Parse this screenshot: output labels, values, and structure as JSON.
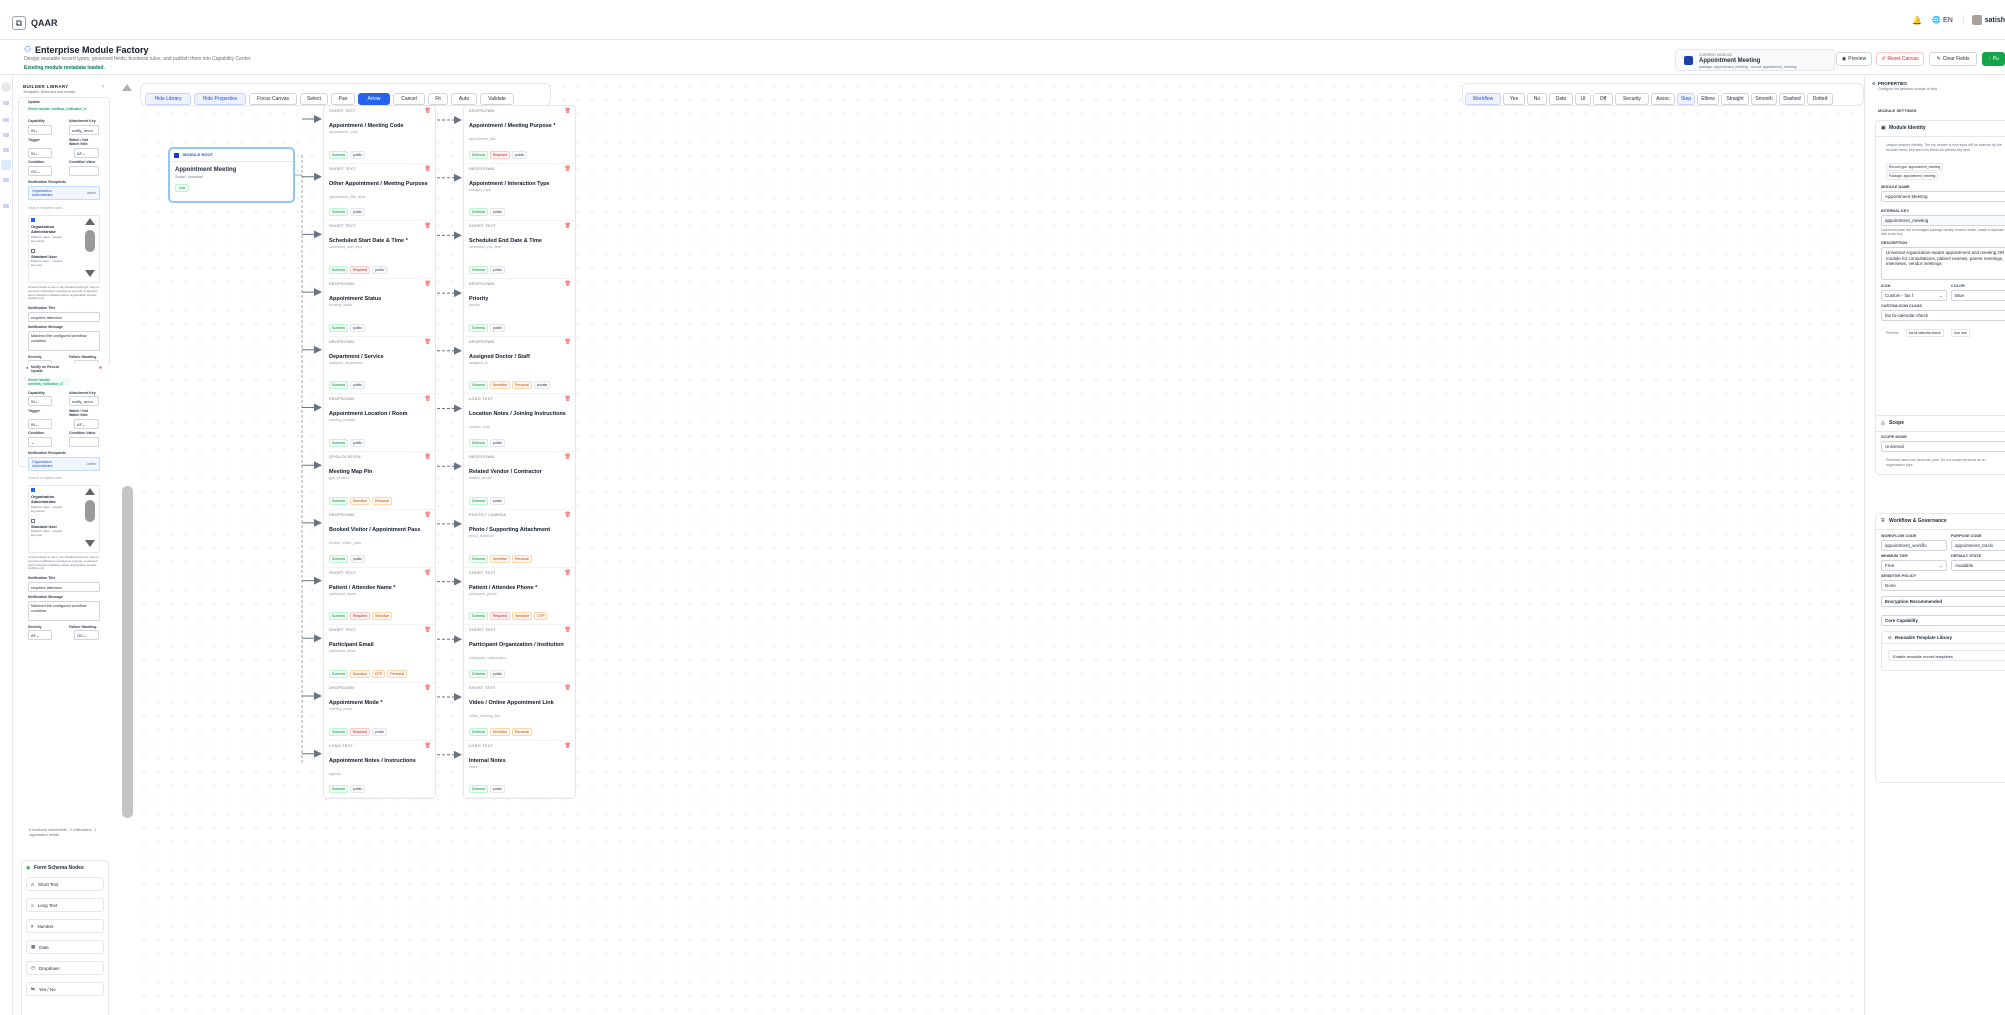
{
  "app": {
    "name": "QAAR",
    "language": "EN",
    "user": "satish"
  },
  "header": {
    "title": "Enterprise Module Factory",
    "subtitle": "Design reusable record types, governed fields, business rules, and publish them into Capability Center.",
    "status": "Existing module metadata loaded.",
    "current_module": {
      "caption": "CURRENT MODULE",
      "name": "Appointment Meeting",
      "path": "package: appointment_meeting · record: appointment_meeting"
    },
    "buttons": {
      "preview": "Preview",
      "reset": "Reset Canvas",
      "clear": "Clear Fields",
      "publish": "Pu"
    }
  },
  "library": {
    "title": "BUILDER LIBRARY",
    "subtitle": "Templates, fields and rule presets",
    "rule1": {
      "title": "Update",
      "code": "Server handler: workflow_notification_r1"
    },
    "rule2": {
      "title": "Notify on Record Update",
      "code": "Server handler: workflow_notification_r2"
    },
    "labels": {
      "capability": "Capability",
      "attr_key": "Attachment Key",
      "trigger": "Trigger",
      "watch": "Watch / Not Watch field",
      "condition": "Condition",
      "cond_value": "Condition Value",
      "recipients": "Notification Recipients",
      "search": "Search recipient roles...",
      "org_admin": "Organization Administrator",
      "org_admin_note": "Platform team · scoped key admin",
      "std_user": "Standard User",
      "std_user_note": "Platform team · scoped key user",
      "help": "Choose Roles to use in any Module Factory's rules to send the notification message to a group. A selected Send selection indicates active organisation access profiles only.",
      "notif_title": "Notification Title",
      "notif_title_val": "requires attention",
      "notif_msg": "Notification Message",
      "notif_msg_val": "Matched the configured workflow condition.",
      "severity": "Severity",
      "failure": "Failure Handling",
      "chip": "Organization Administrator",
      "chip2": "admin",
      "att_val": "notify_recor",
      "s1": "IN",
      "s2": "AF",
      "s3": "OC"
    },
    "summary": "5 functional rules/events · 2 notifications · 1 organisation details",
    "schema": {
      "title": "Form Schema Nodes",
      "items": [
        "Short Text",
        "Long Text",
        "Number",
        "Date",
        "Dropdown",
        "Yes / No"
      ]
    }
  },
  "toolbar": {
    "left": [
      "Hide Library",
      "Hide Properties",
      "Focus Canvas",
      "Select",
      "Pan",
      "Arrow",
      "Cancel",
      "Fit",
      "Auto",
      "Validate"
    ],
    "right": [
      "Workflow",
      "Yes",
      "No",
      "Date",
      "UI",
      "Off",
      "Security",
      "Assoc",
      "Step",
      "Elbow",
      "Straight",
      "Smooth",
      "Dashed",
      "Dotted"
    ]
  },
  "root": {
    "caption": "MODULE ROOT",
    "name": "Appointment Meeting",
    "scope": "Scope · Universal",
    "badge": "root"
  },
  "columns": [
    [
      {
        "type": "SHORT TEXT",
        "label": "Appointment / Meeting Code",
        "key": "appointment_code",
        "tags": [
          "Schema",
          "public"
        ]
      },
      {
        "type": "SHORT TEXT",
        "label": "Other Appointment / Meeting Purpose",
        "key": "appointment_title_other",
        "tags": [
          "Schema",
          "public"
        ]
      },
      {
        "type": "SHORT TEXT",
        "label": "Scheduled Start Date & Time *",
        "key": "scheduled_start_time",
        "tags": [
          "Schema",
          "Required",
          "public"
        ]
      },
      {
        "type": "DROPDOWN",
        "label": "Appointment Status",
        "key": "booking_status",
        "tags": [
          "Schema",
          "public"
        ]
      },
      {
        "type": "DROPDOWN",
        "label": "Department / Service",
        "key": "assigned_department",
        "tags": [
          "Schema",
          "public"
        ]
      },
      {
        "type": "DROPDOWN",
        "label": "Appointment Location / Room",
        "key": "meeting_location",
        "tags": [
          "Schema",
          "public"
        ]
      },
      {
        "type": "GPS/LOCATION",
        "label": "Meeting Map Pin",
        "key": "gps_location",
        "tags": [
          "Schema",
          "Sensitive",
          "Personal"
        ]
      },
      {
        "type": "DROPDOWN",
        "label": "Booked Visitor / Appointment Pass",
        "key": "booked_visitor_pass",
        "tags": [
          "Schema",
          "public"
        ]
      },
      {
        "type": "SHORT TEXT",
        "label": "Patient / Attendee Name *",
        "key": "participant_name",
        "tags": [
          "Schema",
          "Required",
          "Sensitive"
        ]
      },
      {
        "type": "SHORT TEXT",
        "label": "Participant Email",
        "key": "participant_email",
        "tags": [
          "Schema",
          "Sensitive",
          "OTP",
          "Personal"
        ]
      },
      {
        "type": "DROPDOWN",
        "label": "Appointment Mode *",
        "key": "meeting_mode",
        "tags": [
          "Schema",
          "Required",
          "public"
        ]
      },
      {
        "type": "LONG TEXT",
        "label": "Appointment Notes / Instructions",
        "key": "agenda",
        "tags": [
          "Schema",
          "public"
        ]
      }
    ],
    [
      {
        "type": "DROPDOWN",
        "label": "Appointment / Meeting Purpose *",
        "key": "appointment_title",
        "tags": [
          "Schema",
          "Required",
          "public"
        ]
      },
      {
        "type": "DROPDOWN",
        "label": "Appointment / Interaction Type",
        "key": "category_type",
        "tags": [
          "Schema",
          "public"
        ]
      },
      {
        "type": "SHORT TEXT",
        "label": "Scheduled End Date & Time",
        "key": "scheduled_end_time",
        "tags": [
          "Schema",
          "public"
        ]
      },
      {
        "type": "DROPDOWN",
        "label": "Priority",
        "key": "priority",
        "tags": [
          "Schema",
          "public"
        ]
      },
      {
        "type": "DROPDOWN",
        "label": "Assigned Doctor / Staff",
        "key": "assigned_to",
        "tags": [
          "Schema",
          "Sensitive",
          "Personal",
          "private"
        ]
      },
      {
        "type": "LONG TEXT",
        "label": "Location Notes / Joining Instructions",
        "key": "location_note",
        "tags": [
          "Schema",
          "public"
        ]
      },
      {
        "type": "DROPDOWN",
        "label": "Related Vendor / Contractor",
        "key": "related_vendor",
        "tags": [
          "Schema",
          "public"
        ]
      },
      {
        "type": "PHOTO / CAMERA",
        "label": "Photo / Supporting Attachment",
        "key": "photo_evidence",
        "tags": [
          "Schema",
          "Sensitive",
          "Personal"
        ]
      },
      {
        "type": "SHORT TEXT",
        "label": "Patient / Attendee Phone *",
        "key": "participant_phone",
        "tags": [
          "Schema",
          "Required",
          "Sensitive",
          "OTP"
        ]
      },
      {
        "type": "SHORT TEXT",
        "label": "Participant Organization / Institution",
        "key": "participant_organization",
        "tags": [
          "Schema",
          "public"
        ]
      },
      {
        "type": "SHORT TEXT",
        "label": "Video / Online Appointment Link",
        "key": "online_meeting_link",
        "tags": [
          "Schema",
          "Sensitive",
          "Personal"
        ]
      },
      {
        "type": "LONG TEXT",
        "label": "Internal Notes",
        "key": "notes",
        "tags": [
          "Schema",
          "public"
        ]
      }
    ]
  ],
  "props": {
    "title": "PROPERTIES",
    "subtitle": "Configure the selected module or field",
    "settings": "MODULE SETTINGS",
    "identity": {
      "title": "Module Identity",
      "note": "Unique network identity. The top header is how input will be indexed by the module name, key and icon below an identity key here.",
      "chip1": "Record type: appointment_meeting",
      "chip2": "Package: appointment_meeting",
      "name_label": "MODULE NAME",
      "name": "Appointment Meeting",
      "key_label": "INTERNAL KEY",
      "key": "appointment_meeting",
      "key_note": "Locked because this is managed package identity remains stable, create a duplicate with a new key.",
      "desc_label": "DESCRIPTION",
      "desc": "Universal organization-aware appointment and meeting OR module for consultations, patient reviews, parent meetings, interviews, vendor meetings",
      "icon_label": "ICON",
      "icon": "Custom - fas f",
      "color_label": "COLOR",
      "color": "Blue",
      "cls_label": "CUSTOM ICON CLASS",
      "cls": "fas fa-calendar-check",
      "preview": "Preview",
      "preview_chip": "fas fa-calendar-check",
      "preview_chip2": "Icon size"
    },
    "scope": {
      "title": "Scope",
      "mode_label": "SCOPE MODE",
      "mode": "Universal",
      "note": "Personal users use personal_user. Do not scope personal as an organisation type."
    },
    "workflow": {
      "title": "Workflow & Governance",
      "wf_label": "WORKFLOW CODE",
      "wf": "appointment_workflo",
      "pc_label": "PURPOSE CODE",
      "pc": "appointment_tracki",
      "mt_label": "MINIMUM TIER",
      "mt": "Free",
      "ds_label": "DEFAULT STATE",
      "ds": "Available",
      "sp_label": "SENSITIVE POLICY",
      "sp": "None",
      "enc": "Encryption Recommended",
      "core": "Core Capability",
      "reuse": "Reusable Template Library",
      "enable": "Enable reusable record templates"
    }
  }
}
